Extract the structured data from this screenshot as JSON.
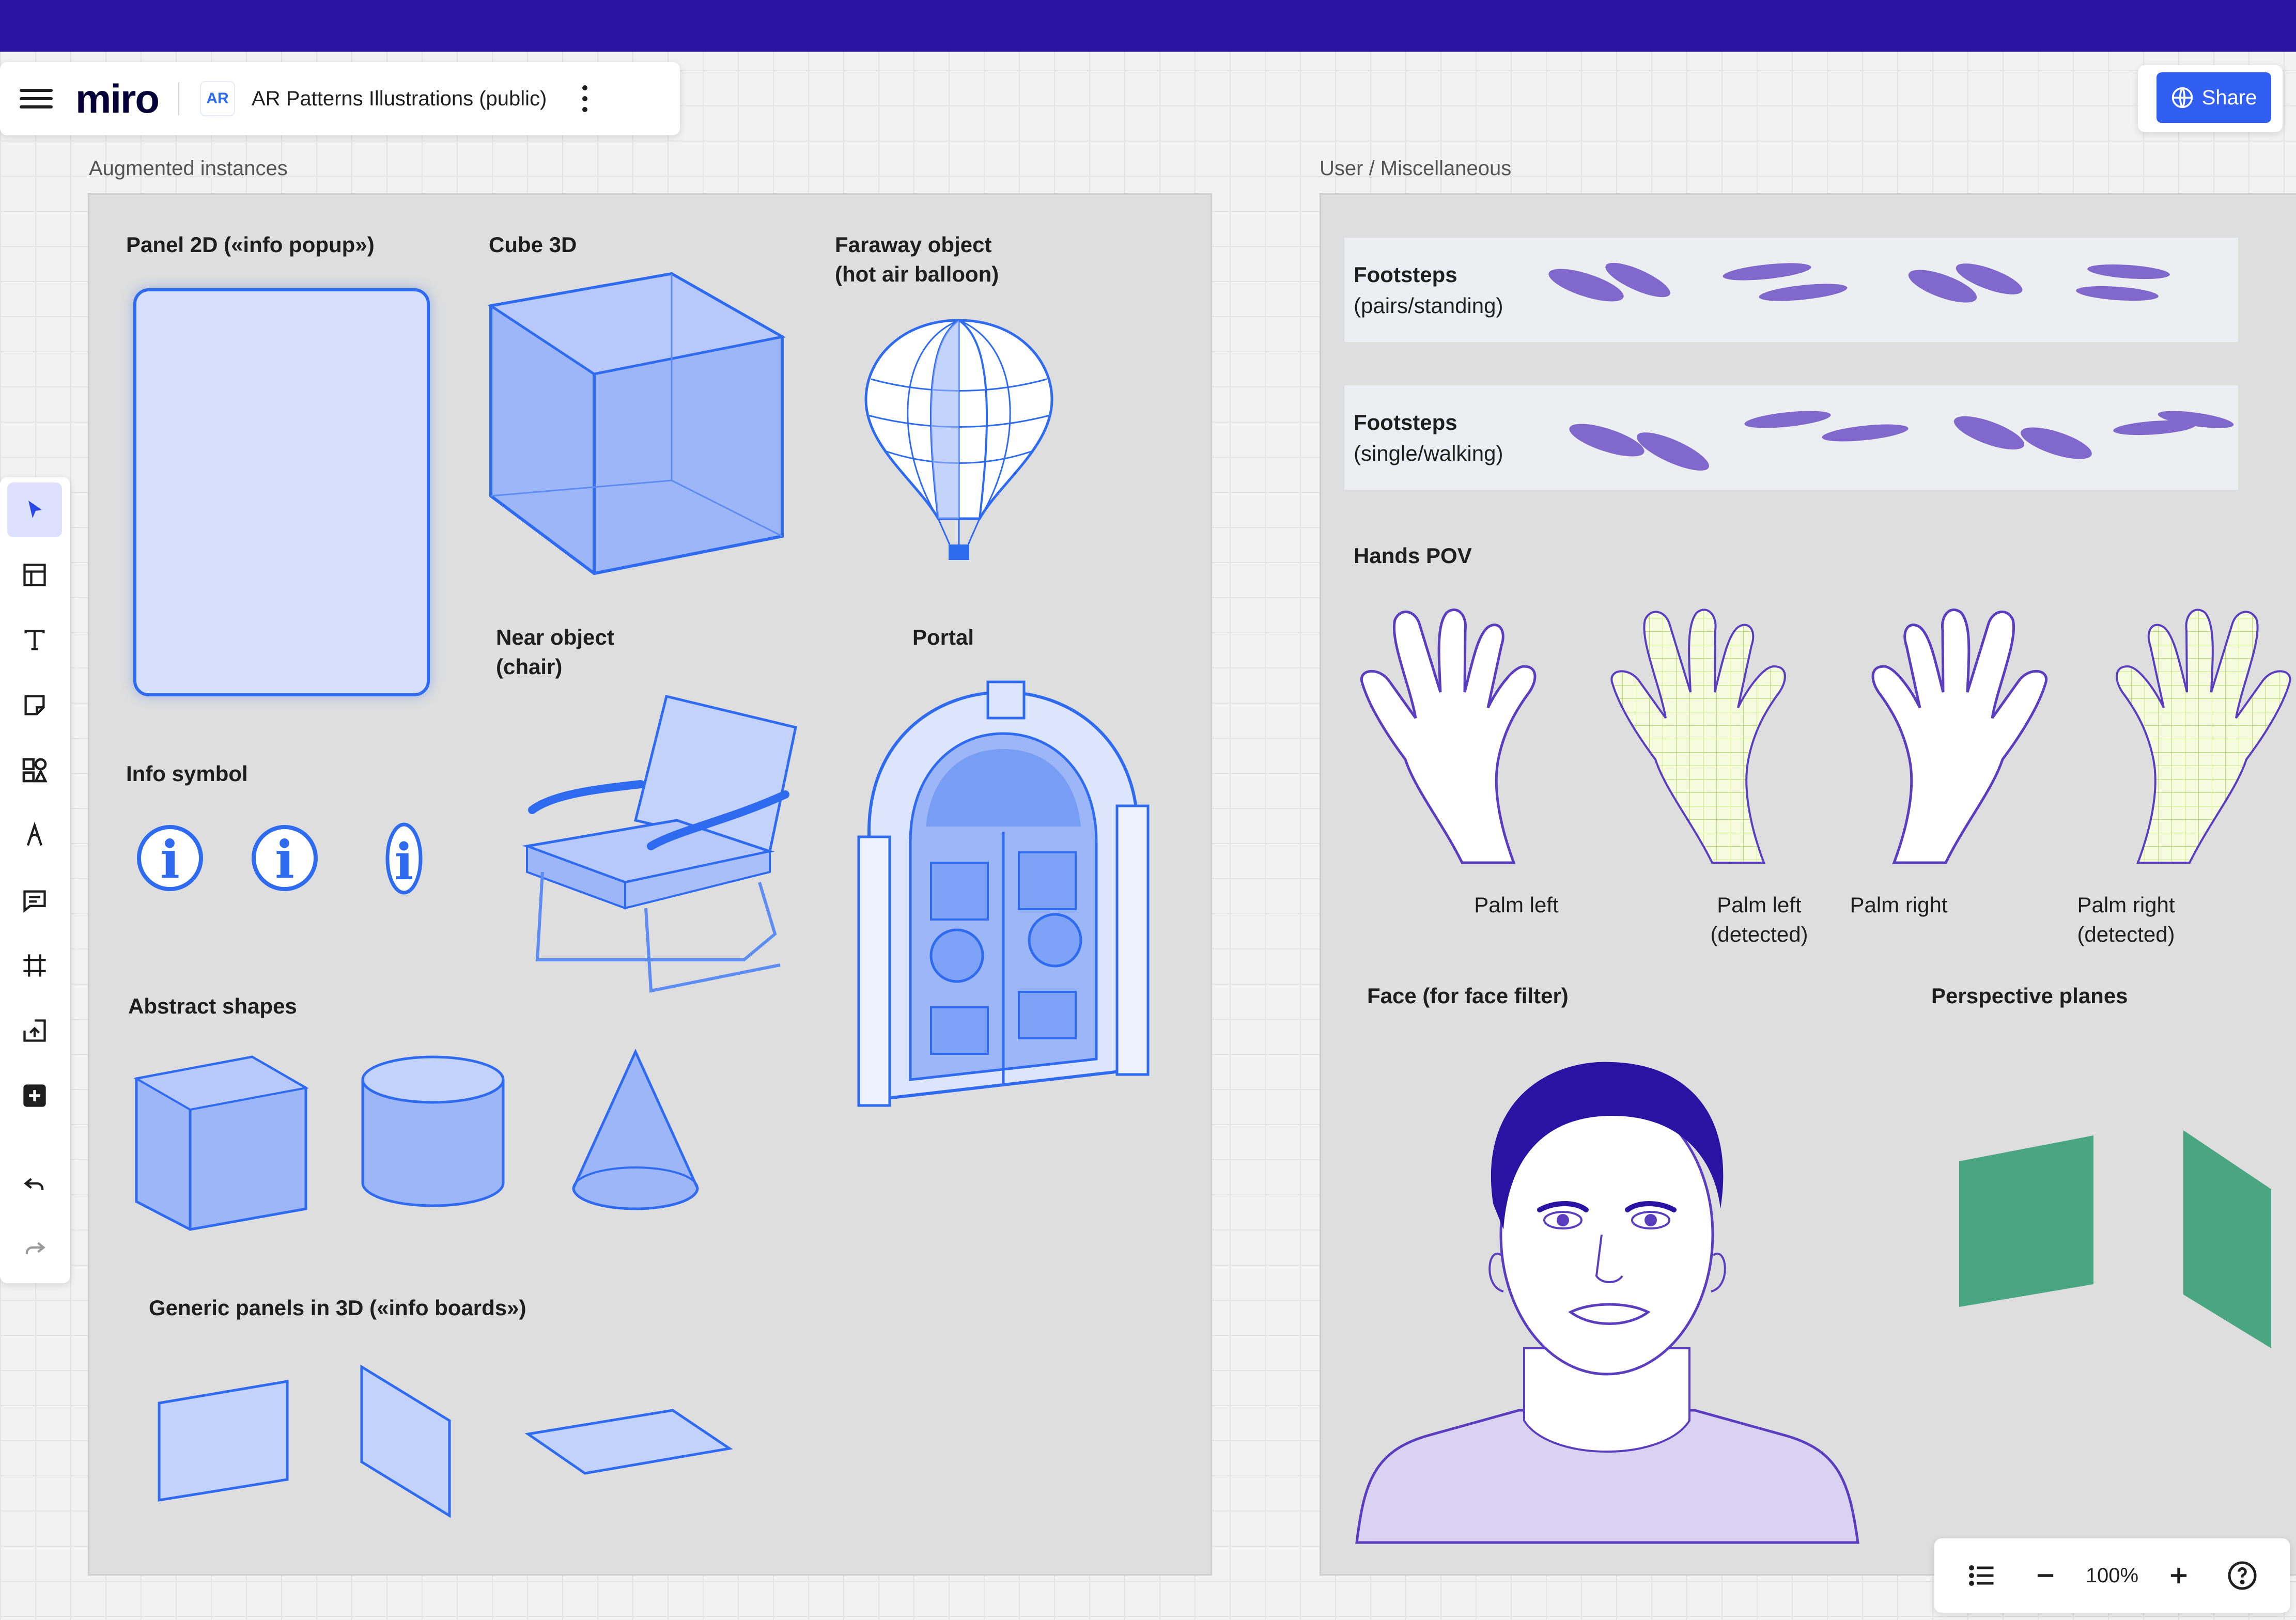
{
  "app": {
    "logo": "miro",
    "board_icon_text": "AR",
    "board_title": "AR Patterns Illustrations (public)",
    "share_label": "Share"
  },
  "frames": {
    "left": {
      "title": "Augmented instances",
      "sections": {
        "panel2d": "Panel 2D («info popup»)",
        "cube3d": "Cube 3D",
        "faraway": "Faraway object\n(hot air balloon)",
        "near": "Near object\n(chair)",
        "portal": "Portal",
        "info": "Info symbol",
        "abstract": "Abstract shapes",
        "generic": "Generic panels in 3D («info boards»)"
      }
    },
    "right": {
      "title": "User / Miscellaneous",
      "footsteps_pairs_title": "Footsteps",
      "footsteps_pairs_sub": "(pairs/standing)",
      "footsteps_single_title": "Footsteps",
      "footsteps_single_sub": "(single/walking)",
      "hands_title": "Hands POV",
      "hands": [
        {
          "label": "Palm left"
        },
        {
          "label": "Palm left\n(detected)"
        },
        {
          "label": "Palm right"
        },
        {
          "label": "Palm right\n(detected)"
        }
      ],
      "face_title": "Face (for face filter)",
      "planes_title": "Perspective planes"
    }
  },
  "toolbar": {
    "tools": [
      {
        "name": "select-tool",
        "icon": "cursor-icon",
        "active": true
      },
      {
        "name": "templates-tool",
        "icon": "template-icon"
      },
      {
        "name": "text-tool",
        "icon": "text-icon"
      },
      {
        "name": "sticky-note-tool",
        "icon": "sticky-note-icon"
      },
      {
        "name": "shapes-tool",
        "icon": "shapes-icon"
      },
      {
        "name": "pen-tool",
        "icon": "pen-icon"
      },
      {
        "name": "comment-tool",
        "icon": "comment-icon"
      },
      {
        "name": "frame-tool",
        "icon": "frame-icon"
      },
      {
        "name": "upload-tool",
        "icon": "upload-icon"
      },
      {
        "name": "more-apps-tool",
        "icon": "plus-square-icon"
      }
    ],
    "undo_icon": "undo-icon",
    "redo_icon": "redo-icon"
  },
  "zoom": {
    "value": "100%"
  },
  "colors": {
    "top_bar": "#2a13a3",
    "accent_blue": "#2f5ef0",
    "illustration_blue": "#2f6bf0",
    "footstep_purple": "#8068cc",
    "plane_green": "#4aa583"
  }
}
